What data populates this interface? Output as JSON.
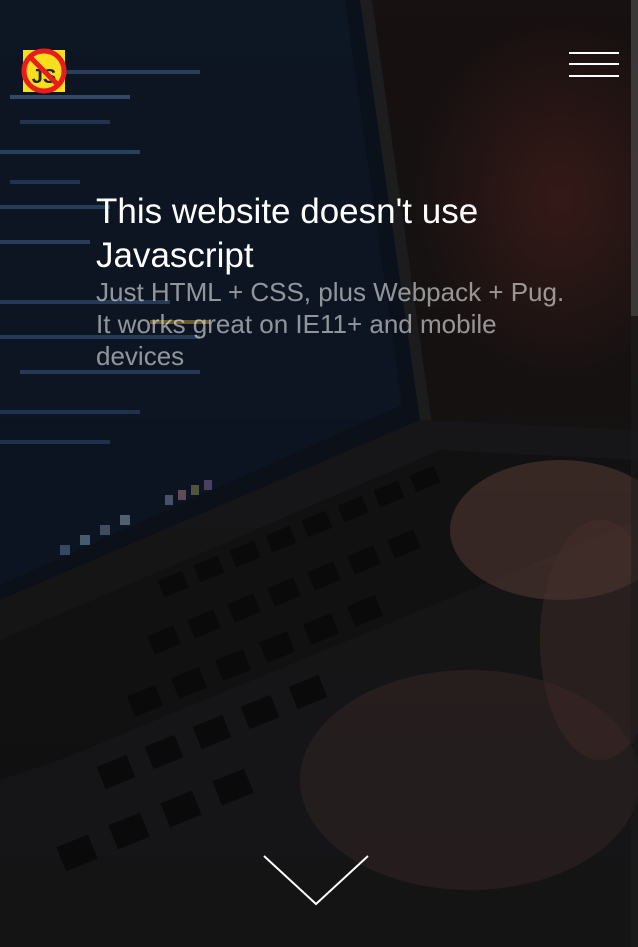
{
  "header": {
    "logo_text": "JS",
    "menu_label": "Menu"
  },
  "hero": {
    "title_strong": "This website",
    "title_rest": " doesn't use Javascript",
    "subtitle_line1": "Just HTML + CSS, plus Webpack + Pug.",
    "subtitle_line2": "It works great on IE11+ and mobile devices"
  },
  "colors": {
    "logo_yellow": "#f7df1e",
    "logo_red": "#e81c1c",
    "text": "#ffffff"
  },
  "icons": {
    "logo": "no-javascript-icon",
    "menu": "hamburger-menu-icon",
    "scroll": "chevron-down-icon"
  }
}
